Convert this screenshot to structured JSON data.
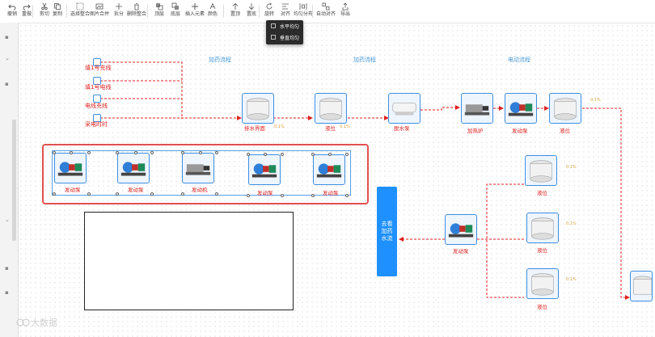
{
  "toolbar": {
    "items": [
      "撤销",
      "重做",
      "剪切",
      "复制",
      "选择整合",
      "图片合并",
      "拆分",
      "删除整合",
      "顶层",
      "底层",
      "插入元素",
      "颜色",
      "置顶",
      "置底",
      "旋转",
      "对齐",
      "均匀分布",
      "自动对齐",
      "导出"
    ]
  },
  "dropdown": {
    "items": [
      "水平均匀",
      "垂直均匀"
    ]
  },
  "canvas": {
    "section_titles": [
      "加药流程",
      "加药流程",
      "电动流程"
    ],
    "inputs": [
      "填1号充线",
      "填1号电线",
      "电线充线",
      "采电时时"
    ],
    "row1_nodes": [
      "排水界面",
      "液位",
      "脱水泵",
      "加热炉",
      "发动泵",
      "液位"
    ],
    "row1_tags": [
      "0.1%",
      "0.1%",
      "0.1%"
    ],
    "group_nodes": [
      "发动泵",
      "发动泵",
      "发动机",
      "发动泵",
      "发动泵"
    ],
    "right_nodes": [
      "液位",
      "液位",
      "发动泵",
      "液位"
    ],
    "right_tags": [
      "0.1%",
      "0.1%",
      "0.1%"
    ],
    "panel_text": "去看加药水流"
  },
  "watermark": "大数据",
  "colors": {
    "accent": "#1e90ff",
    "flow_line": "#e02020",
    "group_border": "#e05050",
    "node_border": "#3d8fe0"
  }
}
